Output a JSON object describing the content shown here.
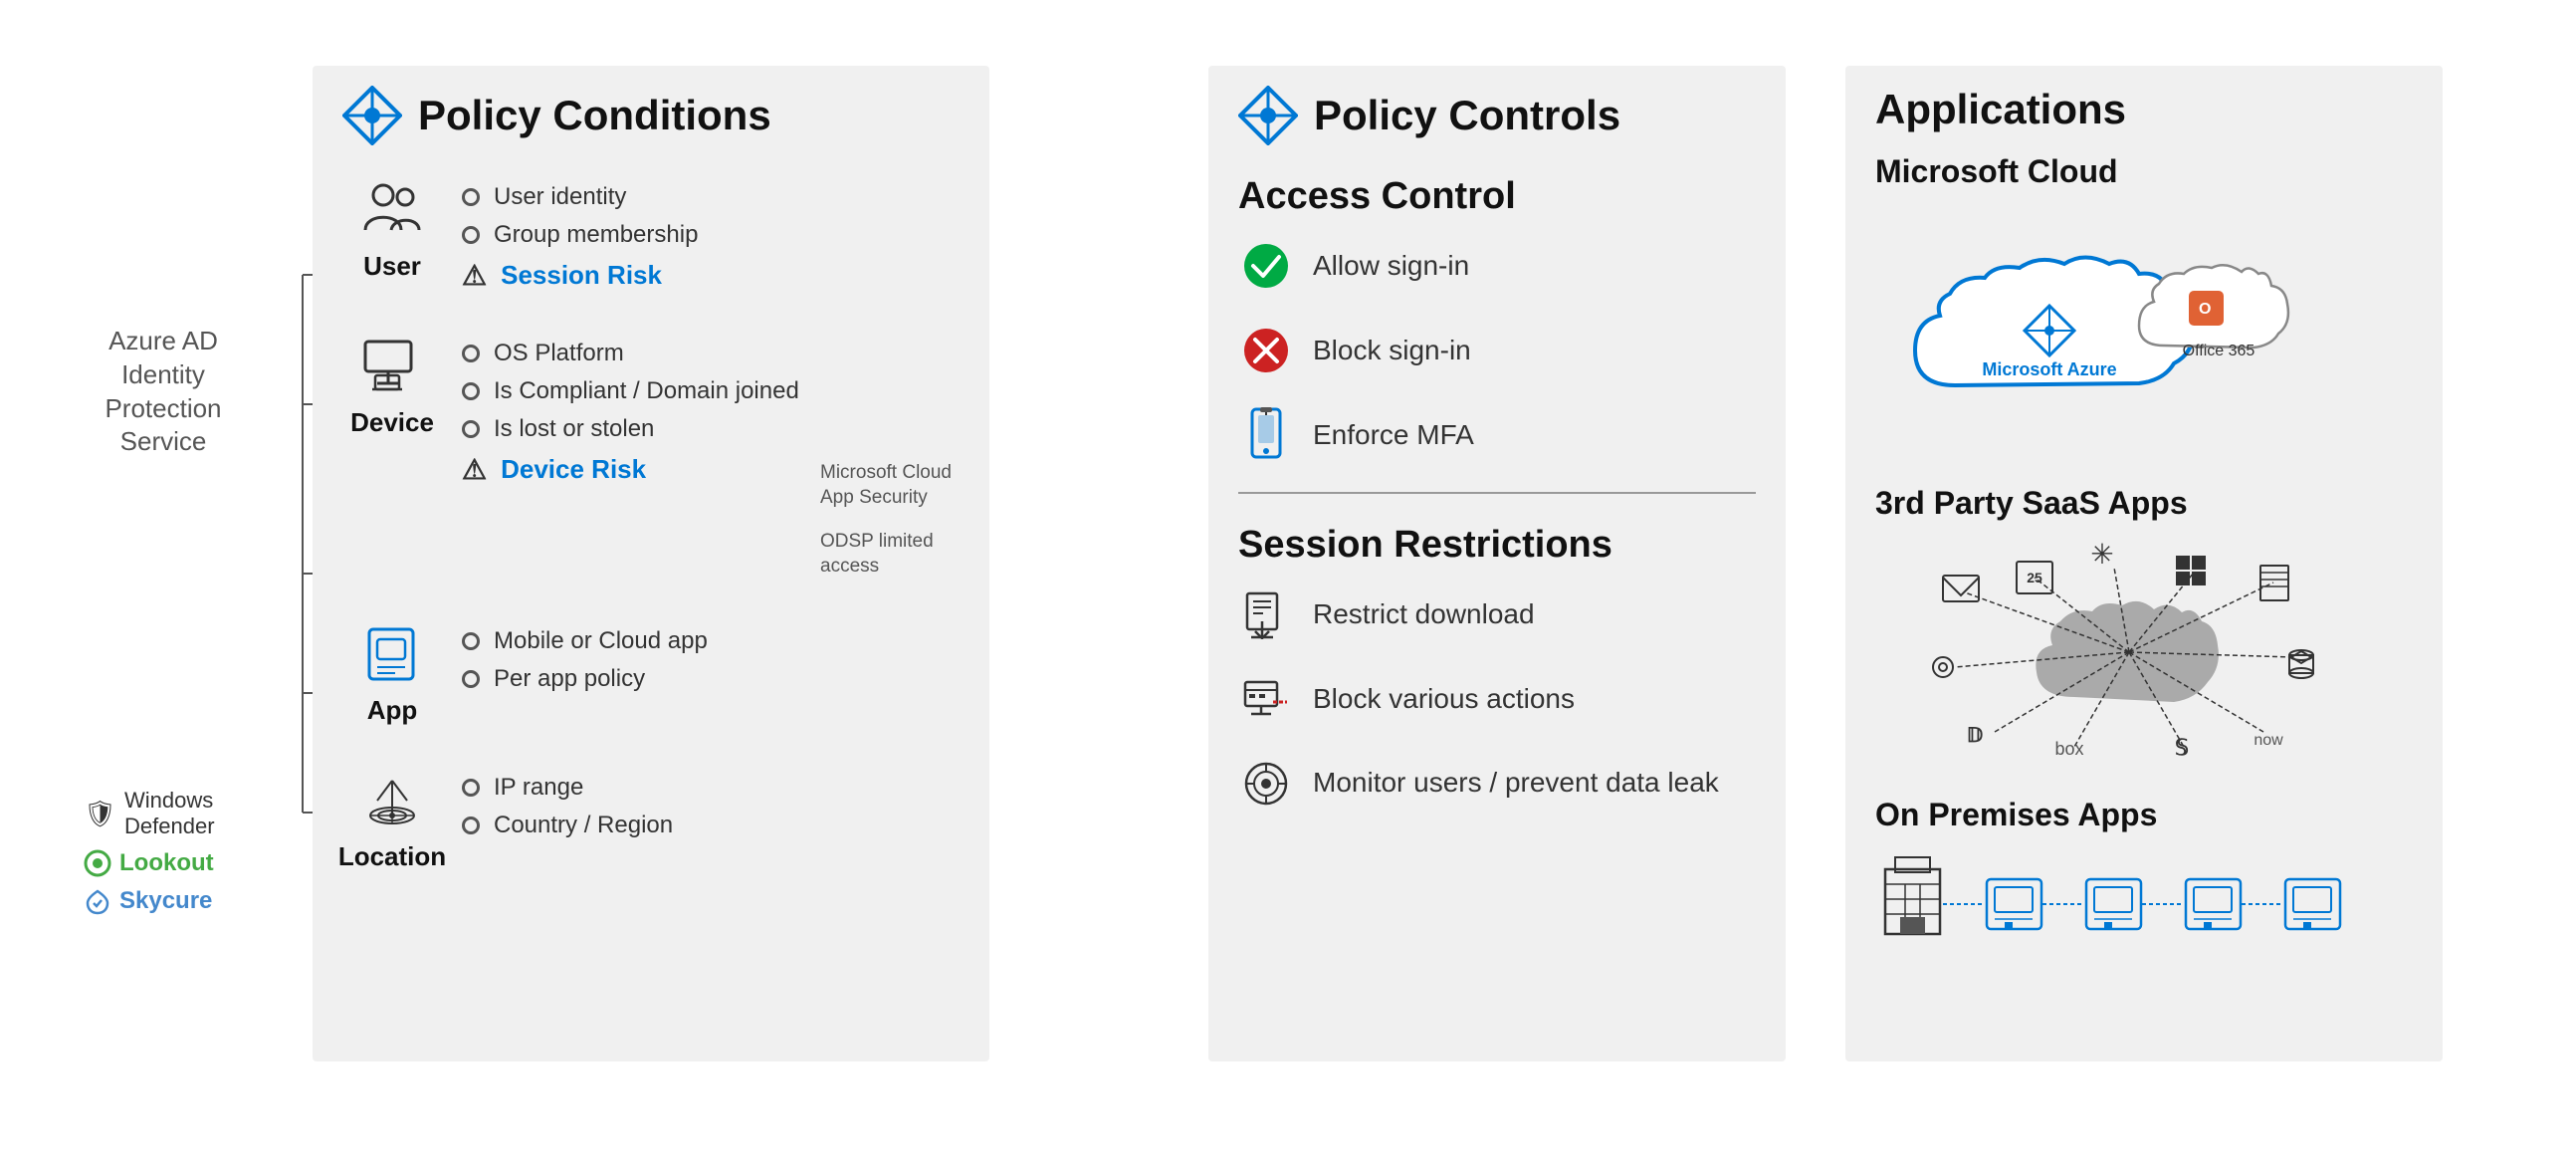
{
  "policy_conditions": {
    "title": "Policy Conditions",
    "sections": {
      "user": {
        "label": "User",
        "items": [
          "User identity",
          "Group membership"
        ],
        "risk": "Session Risk"
      },
      "device": {
        "label": "Device",
        "items": [
          "OS Platform",
          "Is Compliant / Domain joined",
          "Is lost or stolen"
        ],
        "risk": "Device Risk",
        "external_note1": "Microsoft Cloud App Security",
        "external_note2": "ODSP limited access"
      },
      "app": {
        "label": "App",
        "items": [
          "Mobile or Cloud app",
          "Per app policy"
        ]
      },
      "location": {
        "label": "Location",
        "items": [
          "IP range",
          "Country / Region"
        ]
      }
    }
  },
  "policy_controls": {
    "title": "Policy Controls",
    "access_control": {
      "title": "Access Control",
      "items": [
        "Allow sign-in",
        "Block sign-in",
        "Enforce MFA"
      ]
    },
    "session_restrictions": {
      "title": "Session Restrictions",
      "items": [
        "Restrict download",
        "Block various actions",
        "Monitor users / prevent data leak"
      ]
    }
  },
  "applications": {
    "title": "Applications",
    "microsoft_cloud": {
      "title": "Microsoft Cloud",
      "azure_label": "Microsoft Azure",
      "office365_label": "Office 365"
    },
    "saas": {
      "title": "3rd Party SaaS Apps"
    },
    "on_premises": {
      "title": "On Premises Apps"
    }
  },
  "azure_ad": {
    "label": "Azure AD\nIdentity\nProtection\nService"
  },
  "vendors": {
    "defender": "Windows Defender",
    "lookout": "Lookout",
    "skycure": "Skycure"
  }
}
